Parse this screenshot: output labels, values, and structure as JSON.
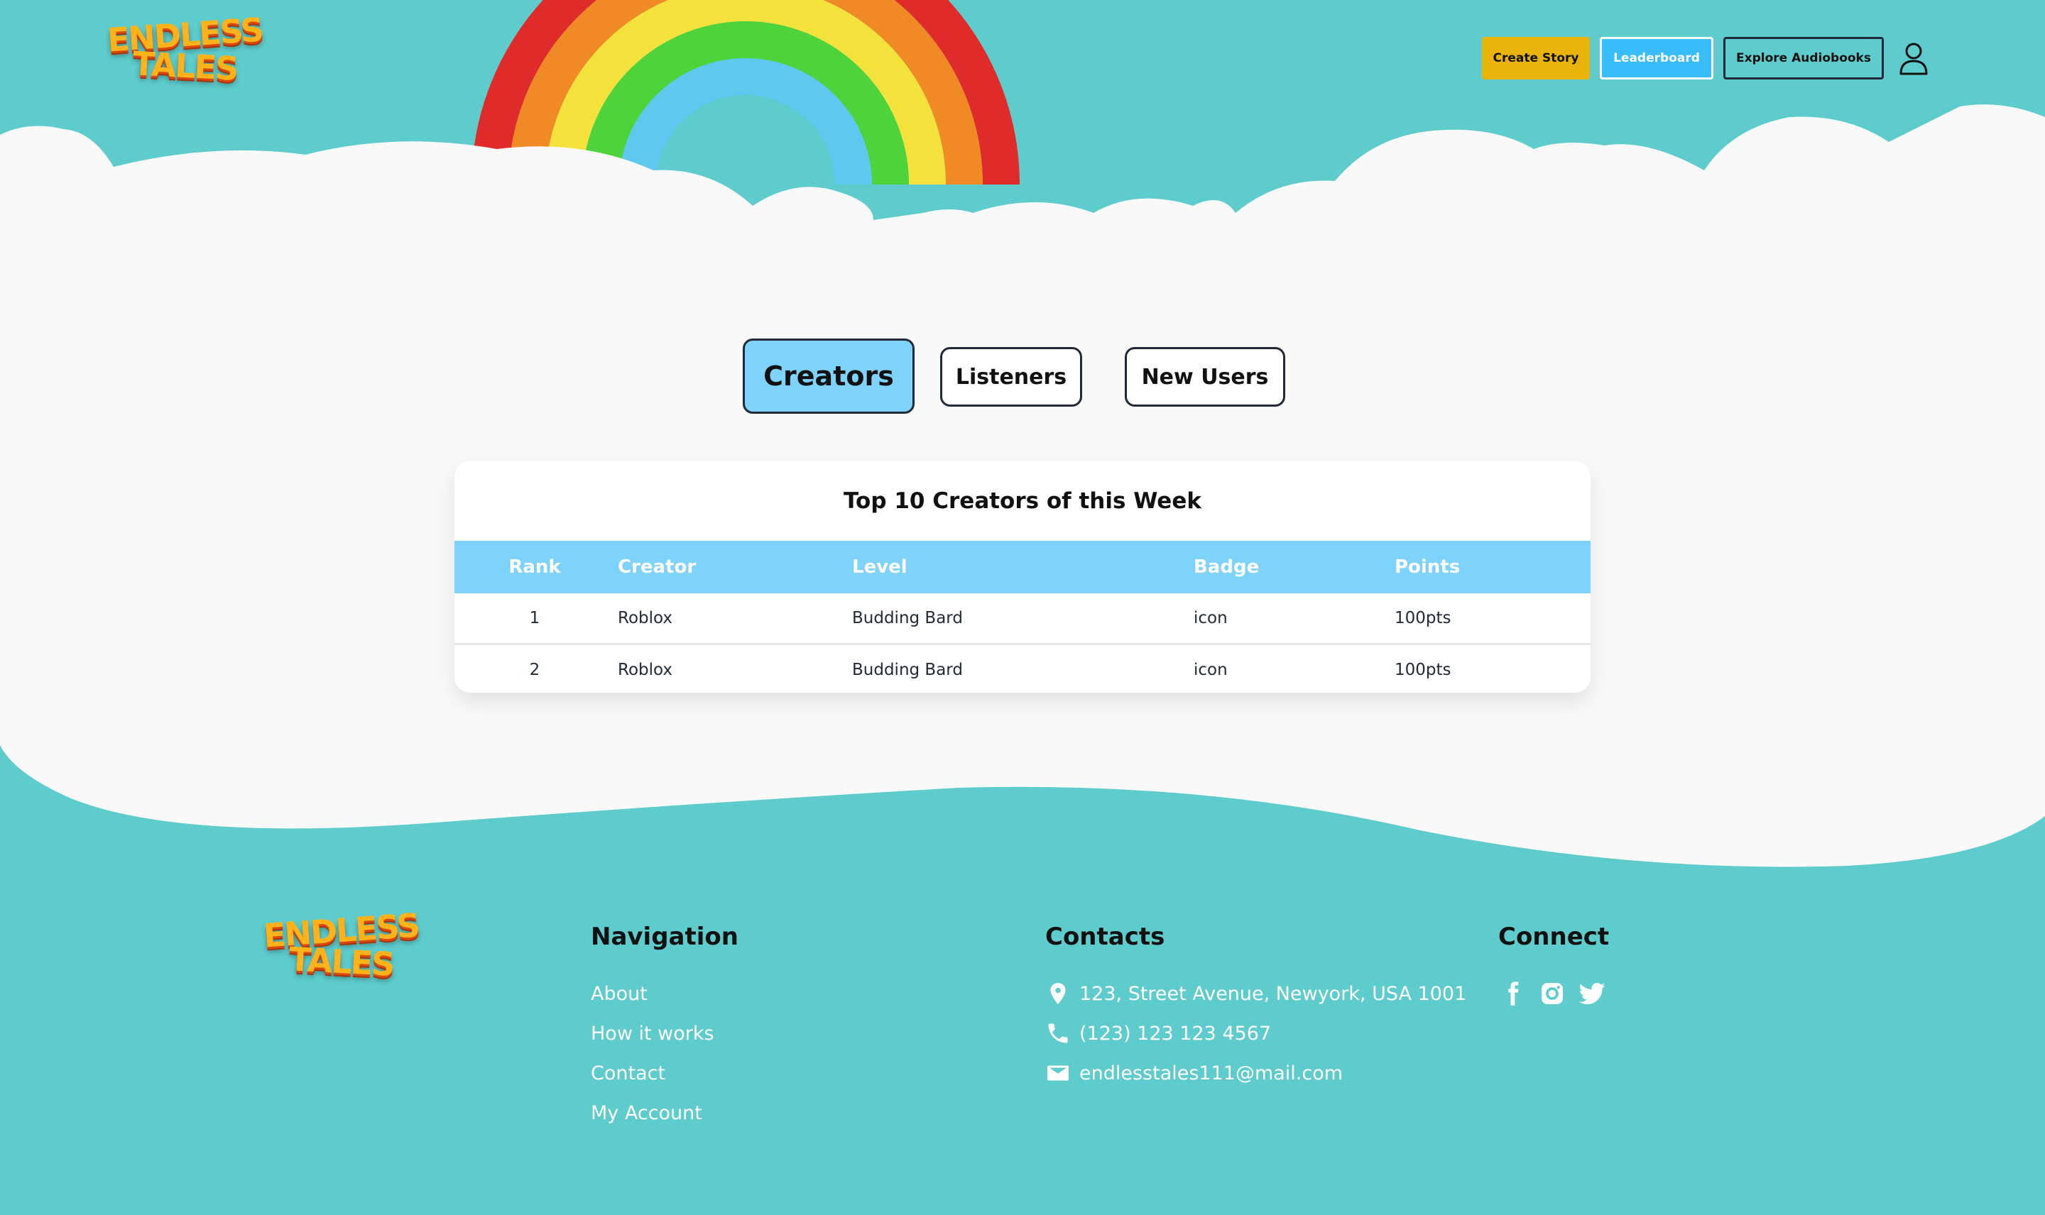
{
  "brand": {
    "line1": "ENDLESS",
    "line2": "TALES"
  },
  "header": {
    "create_label": "Create Story",
    "leaderboard_label": "Leaderboard",
    "explore_label": "Explore Audiobooks",
    "profile_icon": "user-icon"
  },
  "tabs": [
    {
      "label": "Creators",
      "active": true
    },
    {
      "label": "Listeners",
      "active": false
    },
    {
      "label": "New Users",
      "active": false
    }
  ],
  "leaderboard": {
    "title": "Top 10 Creators of this Week",
    "columns": [
      "Rank",
      "Creator",
      "Level",
      "Badge",
      "Points"
    ],
    "rows": [
      {
        "rank": "1",
        "creator": "Roblox",
        "level": "Budding Bard",
        "badge": "icon",
        "points": "100pts"
      },
      {
        "rank": "2",
        "creator": "Roblox",
        "level": "Budding Bard",
        "badge": "icon",
        "points": "100pts"
      }
    ]
  },
  "footer": {
    "navigation": {
      "heading": "Navigation",
      "links": [
        "About",
        "How it works",
        "Contact",
        "My Account"
      ]
    },
    "contacts": {
      "heading": "Contacts",
      "address": "123, Street Avenue, Newyork, USA 1001",
      "phone": "(123) 123 123 4567",
      "email": "endlesstales111@mail.com"
    },
    "connect": {
      "heading": "Connect",
      "icons": [
        "facebook-icon",
        "instagram-icon",
        "twitter-icon"
      ]
    }
  },
  "colors": {
    "teal": "#5ecccc",
    "sky": "#7dd3fc",
    "create_button": "#eab308",
    "leaderboard_button": "#38bdf8"
  }
}
